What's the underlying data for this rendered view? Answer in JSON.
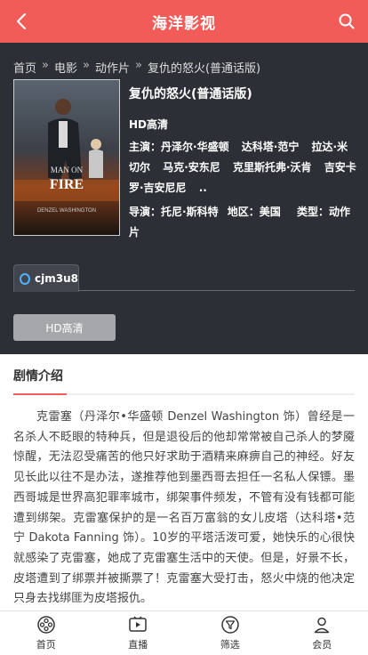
{
  "header": {
    "title": "海洋影视",
    "back_icon": "chevron-left-icon",
    "search_icon": "search-icon"
  },
  "breadcrumb": {
    "items": [
      "首页",
      "电影",
      "动作片",
      "复仇的怒火(普通话版)"
    ],
    "separator": "»"
  },
  "poster": {
    "description": "MAN ON FIRE movie poster",
    "lettering": [
      "DENZEL WASHINGTON",
      "MAN ON FIRE"
    ]
  },
  "movie": {
    "title": "复仇的怒火(普通话版)",
    "quality": "HD高清",
    "cast_label": "主演：",
    "cast": [
      "丹泽尔·华盛顿",
      "达科塔·范宁",
      "拉达·米切尔",
      "马克·安东尼",
      "克里斯托弗·沃肯",
      "吉安卡罗·吉安尼尼",
      ".."
    ],
    "director_label": "导演：",
    "director": "托尼·斯科特",
    "region_label": "地区：",
    "region": "美国",
    "genre_label": "类型：",
    "genre": "动作片"
  },
  "sources": {
    "active": "cjm3u8"
  },
  "episodes": [
    "HD高清"
  ],
  "intro": {
    "heading": "剧情介绍",
    "text": "克雷塞（丹泽尔•华盛顿 Denzel Washington 饰）曾经是一名杀人不眨眼的特种兵，但是退役后的他却常常被自己杀人的梦魇惊醒，无法忍受痛苦的他只好求助于酒精来麻痹自己的神经。好友见长此以往不是办法，遂推荐他到墨西哥去担任一名私人保镖。墨西哥城是世界高犯罪率城市，绑架事件频发，不管有没有钱都可能遭到绑架。克雷塞保护的是一名百万富翁的女儿皮塔（达科塔•范宁 Dakota Fanning 饰）。10岁的平塔活泼可爱，她快乐的心很快就感染了克雷塞，她成了克雷塞生活中的天使。但是，好景不长，皮塔遭到了绑票并被撕票了！克雷塞大受打击，怒火中烧的他决定只身去找绑匪为皮塔报仇。"
  },
  "tabbar": [
    {
      "label": "首页",
      "icon": "film-reel-icon"
    },
    {
      "label": "直播",
      "icon": "tv-play-icon"
    },
    {
      "label": "筛选",
      "icon": "filter-icon"
    },
    {
      "label": "会员",
      "icon": "user-icon"
    }
  ],
  "colors": {
    "accent": "#f25c58",
    "dark_bg": "#2d2f36",
    "source_ring": "#4fb3ff"
  }
}
